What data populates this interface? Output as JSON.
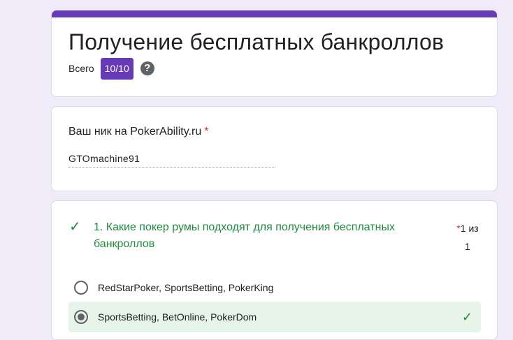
{
  "form": {
    "title": "Получение бесплатных банкроллов",
    "score_label": "Всего",
    "score_value": "10/10",
    "help_icon": "help-icon"
  },
  "nick_question": {
    "label": "Ваш ник на PokerAbility.ru",
    "required_mark": "*",
    "answer": "GTOmachine91"
  },
  "question_1": {
    "status_icon": "check-icon",
    "title": "1. Какие покер румы подходят для получения бесплатных банкроллов",
    "required_mark": "*",
    "points_line1": "1 из",
    "points_line2": "1",
    "options": [
      {
        "label": "RedStarPoker, SportsBetting, PokerKing",
        "selected": false
      },
      {
        "label": "SportsBetting, BetOnline, PokerDom",
        "selected": true,
        "correct": true
      }
    ]
  },
  "colors": {
    "accent": "#673ab7",
    "background": "#f0ebf8",
    "correct": "#1e8e3e",
    "required": "#d93025"
  }
}
